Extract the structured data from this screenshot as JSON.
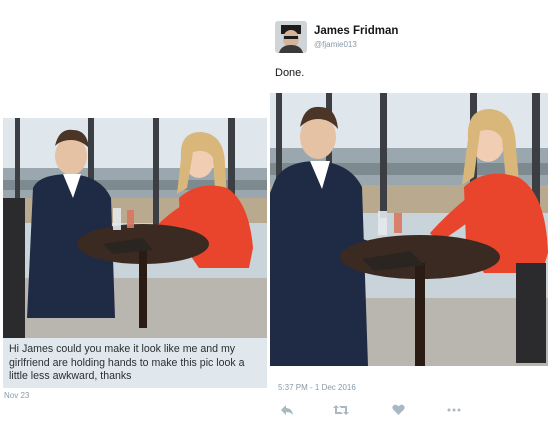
{
  "request": {
    "message": "Hi James could you make it look like me and my girlfriend are holding hands to make this pic look a little less awkward, thanks",
    "date": "Nov 23",
    "photo_icon": "restaurant-photo-original"
  },
  "tweet": {
    "author_name": "James Fridman",
    "author_handle": "@fjamie013",
    "text": "Done.",
    "timestamp": "5:37 PM - 1 Dec 2016",
    "photo_icon": "restaurant-photo-edited",
    "actions": [
      "reply-icon",
      "retweet-icon",
      "like-icon",
      "more-icon"
    ]
  },
  "colors": {
    "message_bg": "#e1e8ed",
    "muted_text": "#8899a6",
    "action_icon": "#aab8c2",
    "dress_red": "#e8452c",
    "suit_navy": "#1f2a44",
    "table": "#3a2a22"
  }
}
